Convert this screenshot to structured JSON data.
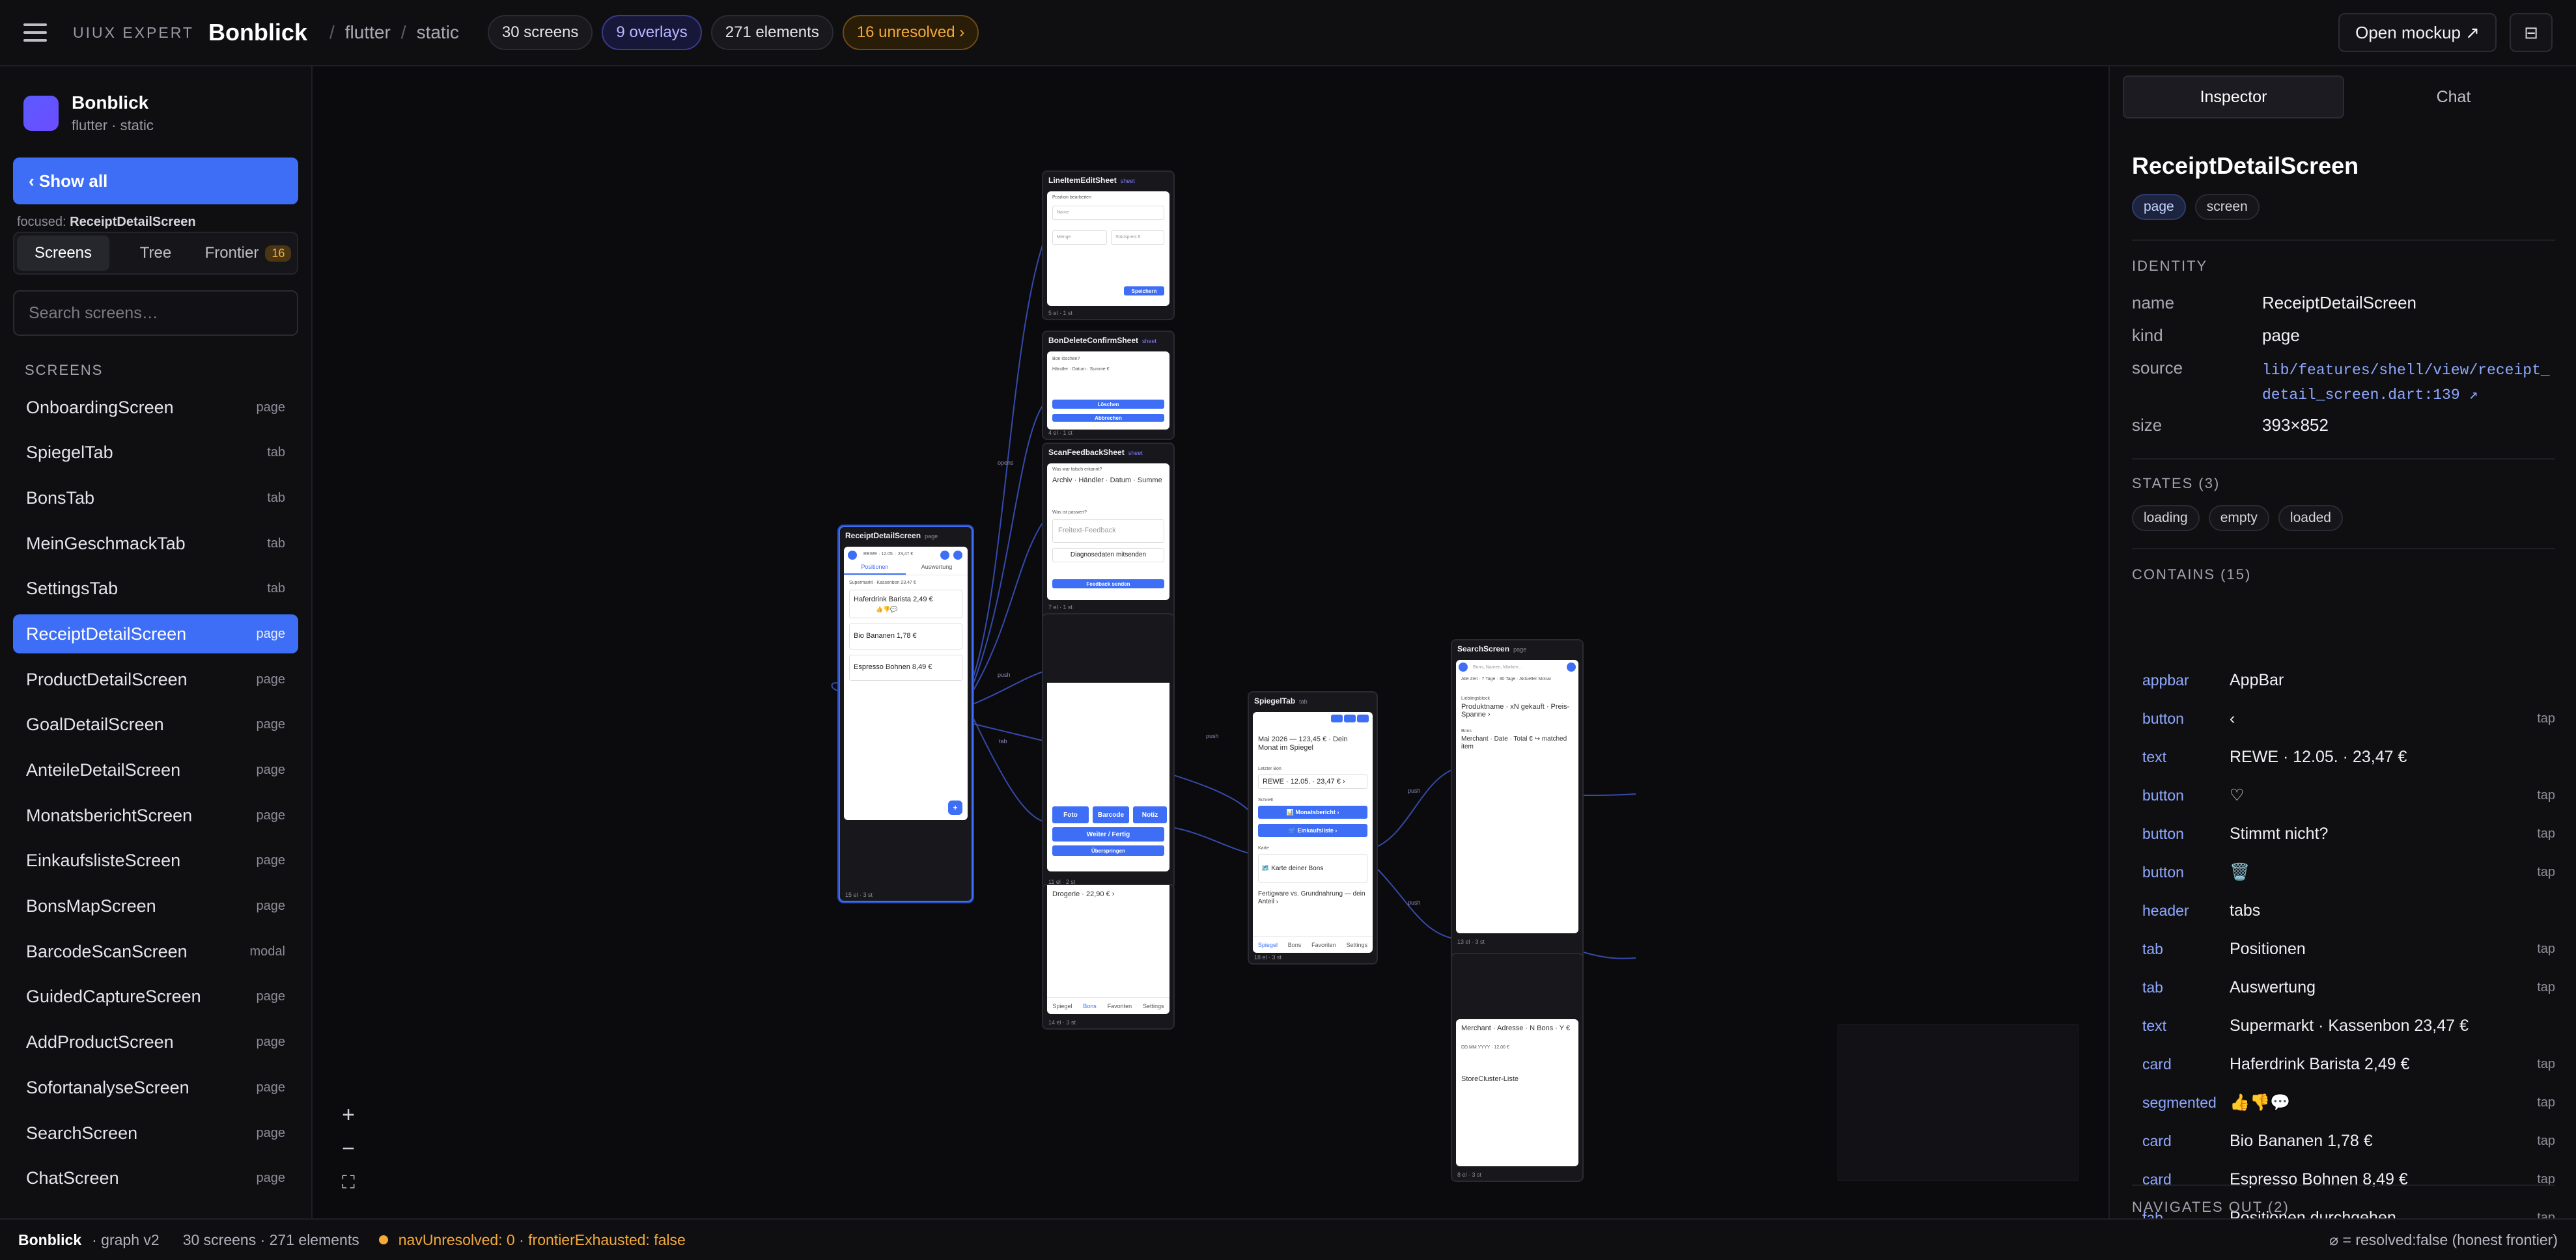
{
  "topbar": {
    "brand": "UIUX EXPERT",
    "project": "Bonblick",
    "crumb1": "flutter",
    "crumb2": "static",
    "screens_pill": "30 screens",
    "overlays_pill": "9 overlays",
    "elements_pill": "271 elements",
    "unresolved_pill": "16 unresolved ›",
    "open_mockup": "Open mockup ↗",
    "panel_toggle": "⊟"
  },
  "sidebar": {
    "app_name": "Bonblick",
    "app_sub": "flutter · static",
    "show_all": "‹ Show all",
    "focused_label": "focused:",
    "focused_value": "ReceiptDetailScreen",
    "tabs": {
      "screens": "Screens",
      "tree": "Tree",
      "frontier": "Frontier",
      "frontier_count": "16"
    },
    "search_placeholder": "Search screens…",
    "section_title": "SCREENS",
    "items": [
      {
        "name": "OnboardingScreen",
        "kind": "page"
      },
      {
        "name": "SpiegelTab",
        "kind": "tab"
      },
      {
        "name": "BonsTab",
        "kind": "tab"
      },
      {
        "name": "MeinGeschmackTab",
        "kind": "tab"
      },
      {
        "name": "SettingsTab",
        "kind": "tab"
      },
      {
        "name": "ReceiptDetailScreen",
        "kind": "page",
        "selected": true
      },
      {
        "name": "ProductDetailScreen",
        "kind": "page"
      },
      {
        "name": "GoalDetailScreen",
        "kind": "page"
      },
      {
        "name": "AnteileDetailScreen",
        "kind": "page"
      },
      {
        "name": "MonatsberichtScreen",
        "kind": "page"
      },
      {
        "name": "EinkaufslisteScreen",
        "kind": "page"
      },
      {
        "name": "BonsMapScreen",
        "kind": "page"
      },
      {
        "name": "BarcodeScanScreen",
        "kind": "modal"
      },
      {
        "name": "GuidedCaptureScreen",
        "kind": "page"
      },
      {
        "name": "AddProductScreen",
        "kind": "page"
      },
      {
        "name": "SofortanalyseScreen",
        "kind": "page"
      },
      {
        "name": "SearchScreen",
        "kind": "page"
      },
      {
        "name": "ChatScreen",
        "kind": "page"
      }
    ]
  },
  "canvas": {
    "zoom_in": "+",
    "zoom_out": "−",
    "fit": "⛶",
    "frames": {
      "lineitem": {
        "title": "LineItemEditSheet",
        "kind": "sheet",
        "foot": "5 el · 1 st",
        "l1": "Position bearbeiten",
        "name_ph": "Name",
        "menge": "Menge",
        "stueck": "Stückpreis €",
        "save": "Speichern"
      },
      "bondelete": {
        "title": "BonDeleteConfirmSheet",
        "kind": "sheet",
        "foot": "4 el · 1 st",
        "l1": "Bon löschen?",
        "l2": "Händler · Datum · Summe €",
        "delete": "Löschen",
        "cancel": "Abbrechen"
      },
      "scanfb": {
        "title": "ScanFeedbackSheet",
        "kind": "sheet",
        "foot": "7 el · 1 st",
        "l1": "Was war falsch erkannt?",
        "chips": "Archiv · Händler · Datum · Summe",
        "l2": "Was ist passiert?",
        "ph": "Freitext-Feedback",
        "diag": "Diagnosedaten mitsenden",
        "send": "Feedback senden"
      },
      "receipt": {
        "title": "ReceiptDetailScreen",
        "kind": "page",
        "foot": "15 el · 3 st",
        "header": "REWE · 12.05. · 23,47 €",
        "tab1": "Positionen",
        "tab2": "Auswertung",
        "sub": "Supermarkt · Kassenbon 23,47 €",
        "c1": "Haferdrink Barista 2,49 €",
        "c1b": "👍👎💬",
        "c2": "Bio Bananen 1,78 €",
        "c3": "Espresso Bohnen 8,49 €",
        "fab": "+"
      },
      "capture": {
        "foot": "11 el · 2 st",
        "b1": "Foto",
        "b2": "Barcode",
        "b3": "Notiz",
        "b4": "Weiter / Fertig",
        "b5": "Überspringen"
      },
      "bons": {
        "foot": "14 el · 3 st",
        "row": "Drogerie · 22,90 € ›",
        "nav1": "Spiegel",
        "nav2": "Bons",
        "nav3": "Favoriten",
        "nav4": "Settings"
      },
      "spiegel": {
        "title": "SpiegelTab",
        "kind": "tab",
        "foot": "18 el · 3 st",
        "l1": "Mai 2026 — 123,45 € · Dein Monat im Spiegel",
        "l2": "Letzter Bon",
        "l3": "REWE · 12.05. · 23,47 € ›",
        "l4": "Schnell",
        "b1": "📊 Monatsbericht ›",
        "b2": "🛒 Einkaufsliste ›",
        "l5": "Karte",
        "l6": "🗺️ Karte deiner Bons",
        "l7": "Fertigware vs. Grundnahrung — dein Anteil ›",
        "nav1": "Spiegel",
        "nav2": "Bons",
        "nav3": "Favoriten",
        "nav4": "Settings"
      },
      "search": {
        "title": "SearchScreen",
        "kind": "page",
        "foot": "13 el · 3 st",
        "ph": "Bons, Namen, Marken…",
        "chips": "Alle Zeit · 7 Tage · 30 Tage · Aktueller Monat",
        "l1": "Lieblingsblock",
        "l2": "Produktname · xN gekauft · Preis-Spanne ›",
        "l3": "Bons",
        "l4": "Merchant · Date · Total € ↪ matched item"
      },
      "bonsmap": {
        "foot": "8 el · 3 st",
        "l1": "Merchant · Adresse · N Bons · Y €",
        "l2": "DD.MM.YYYY · 12,00 €",
        "l3": "StoreCluster-Liste"
      }
    },
    "edges": {
      "push": "push",
      "opens": "opens",
      "tab": "tab"
    }
  },
  "inspector": {
    "tab_inspector": "Inspector",
    "tab_chat": "Chat",
    "title": "ReceiptDetailScreen",
    "chips": [
      "page",
      "screen"
    ],
    "identity_title": "IDENTITY",
    "identity": [
      {
        "k": "name",
        "v": "ReceiptDetailScreen"
      },
      {
        "k": "kind",
        "v": "page"
      },
      {
        "k": "source",
        "v": "lib/features/shell/view/receipt_detail_screen.dart:139 ↗"
      },
      {
        "k": "size",
        "v": "393×852"
      }
    ],
    "states_title": "STATES (3)",
    "states": [
      "loading",
      "empty",
      "loaded"
    ],
    "contains_title": "CONTAINS (15)",
    "contains": [
      {
        "type": "appbar",
        "label": "AppBar",
        "action": ""
      },
      {
        "type": "button",
        "label": "‹",
        "action": "tap"
      },
      {
        "type": "text",
        "label": "REWE · 12.05. · 23,47 €",
        "action": ""
      },
      {
        "type": "button",
        "label": "♡",
        "action": "tap"
      },
      {
        "type": "button",
        "label": "Stimmt nicht?",
        "action": "tap"
      },
      {
        "type": "button",
        "label": "🗑️",
        "action": "tap"
      },
      {
        "type": "header",
        "label": "tabs",
        "action": ""
      },
      {
        "type": "tab",
        "label": "Positionen",
        "action": "tap"
      },
      {
        "type": "tab",
        "label": "Auswertung",
        "action": "tap"
      },
      {
        "type": "text",
        "label": "Supermarkt · Kassenbon 23,47 €",
        "action": ""
      },
      {
        "type": "card",
        "label": "Haferdrink Barista 2,49 €",
        "action": "tap"
      },
      {
        "type": "segmented",
        "label": "👍👎💬",
        "action": "tap"
      },
      {
        "type": "card",
        "label": "Bio Bananen 1,78 €",
        "action": "tap"
      },
      {
        "type": "card",
        "label": "Espresso Bohnen 8,49 €",
        "action": "tap"
      },
      {
        "type": "fab",
        "label": "Positionen durchgehen",
        "action": "tap"
      }
    ],
    "navigates_title": "NAVIGATES OUT (2)"
  },
  "status": {
    "app": "Bonblick",
    "graph": "· graph v2",
    "counts": "30 screens · 271 elements",
    "flags": "navUnresolved: 0 · frontierExhausted: false",
    "legend": "⌀ = resolved:false (honest frontier)"
  },
  "colors": {
    "accent": "#3d6ef5",
    "warning": "#f4a93a",
    "overlay": "#b9b9ff"
  }
}
